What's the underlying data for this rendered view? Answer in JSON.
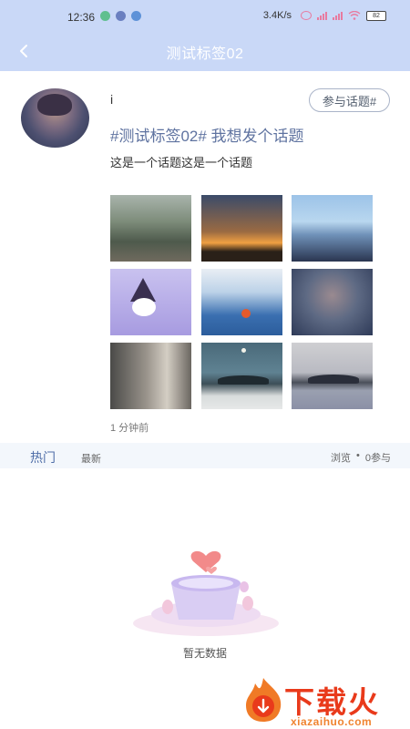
{
  "status_bar": {
    "time": "12:36",
    "speed": "3.4K/s",
    "battery": "82",
    "bar_color": "#c9d8f7"
  },
  "nav": {
    "title": "测试标签02",
    "back_icon": "chevron-left-icon"
  },
  "post": {
    "username": "i",
    "join_label": "参与话题#",
    "title": "#测试标签02# 我想发个话题",
    "body": "这是一个话题这是一个话题",
    "timestamp": "1 分钟前",
    "image_count": 9
  },
  "tabs": {
    "hot_label": "热门",
    "new_label": "最新",
    "views_label": "浏览",
    "separator": "•",
    "participants_label": "0参与"
  },
  "empty_state": {
    "text": "暂无数据",
    "icon": "empty-box-heart-icon"
  },
  "watermark": {
    "brand": "下载火",
    "url": "xiazaihuo.com"
  },
  "colors": {
    "accent": "#5f73a0",
    "tab_active": "#4f6ea8",
    "watermark_red": "#e93a1b",
    "watermark_orange": "#f08430"
  }
}
